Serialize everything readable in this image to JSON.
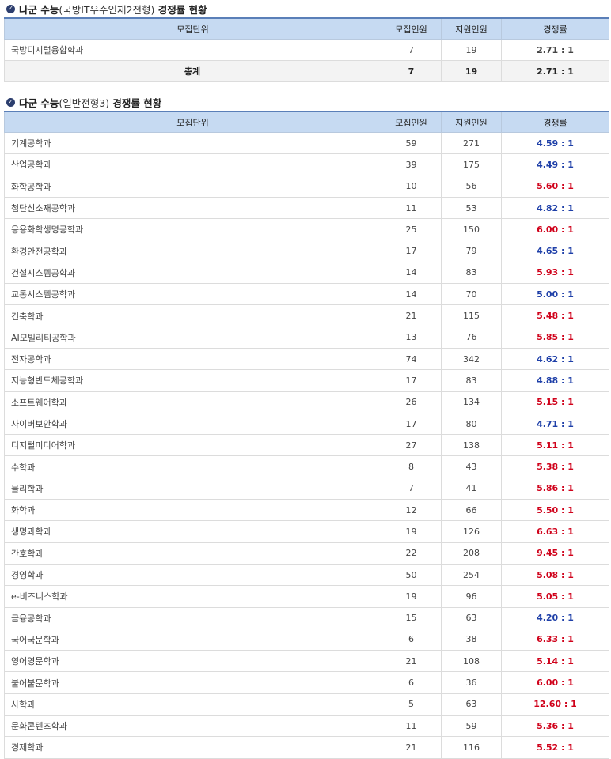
{
  "section1": {
    "title_main": "나군 수능",
    "title_paren": "(국방IT우수인재2전형)",
    "title_tail": " 경쟁률 현황",
    "headers": [
      "모집단위",
      "모집인원",
      "지원인원",
      "경쟁률"
    ],
    "rows": [
      {
        "name": "국방디지털융합학과",
        "quota": "7",
        "applicants": "19",
        "rate": "2.71 : 1"
      }
    ],
    "total": {
      "name": "총계",
      "quota": "7",
      "applicants": "19",
      "rate": "2.71 : 1"
    }
  },
  "section2": {
    "title_main": "다군 수능",
    "title_paren": "(일반전형3)",
    "title_tail": " 경쟁률 현황",
    "headers": [
      "모집단위",
      "모집인원",
      "지원인원",
      "경쟁률"
    ],
    "rows": [
      {
        "name": "기계공학과",
        "quota": "59",
        "applicants": "271",
        "rate": "4.59 : 1",
        "color": "#1e3fa8"
      },
      {
        "name": "산업공학과",
        "quota": "39",
        "applicants": "175",
        "rate": "4.49 : 1",
        "color": "#1e3fa8"
      },
      {
        "name": "화학공학과",
        "quota": "10",
        "applicants": "56",
        "rate": "5.60 : 1",
        "color": "#d0021b"
      },
      {
        "name": "첨단신소재공학과",
        "quota": "11",
        "applicants": "53",
        "rate": "4.82 : 1",
        "color": "#1e3fa8"
      },
      {
        "name": "응용화학생명공학과",
        "quota": "25",
        "applicants": "150",
        "rate": "6.00 : 1",
        "color": "#d0021b"
      },
      {
        "name": "환경안전공학과",
        "quota": "17",
        "applicants": "79",
        "rate": "4.65 : 1",
        "color": "#1e3fa8"
      },
      {
        "name": "건설시스템공학과",
        "quota": "14",
        "applicants": "83",
        "rate": "5.93 : 1",
        "color": "#d0021b"
      },
      {
        "name": "교통시스템공학과",
        "quota": "14",
        "applicants": "70",
        "rate": "5.00 : 1",
        "color": "#1e3fa8"
      },
      {
        "name": "건축학과",
        "quota": "21",
        "applicants": "115",
        "rate": "5.48 : 1",
        "color": "#d0021b"
      },
      {
        "name": "AI모빌리티공학과",
        "quota": "13",
        "applicants": "76",
        "rate": "5.85 : 1",
        "color": "#d0021b"
      },
      {
        "name": "전자공학과",
        "quota": "74",
        "applicants": "342",
        "rate": "4.62 : 1",
        "color": "#1e3fa8"
      },
      {
        "name": "지능형반도체공학과",
        "quota": "17",
        "applicants": "83",
        "rate": "4.88 : 1",
        "color": "#1e3fa8"
      },
      {
        "name": "소프트웨어학과",
        "quota": "26",
        "applicants": "134",
        "rate": "5.15 : 1",
        "color": "#d0021b"
      },
      {
        "name": "사이버보안학과",
        "quota": "17",
        "applicants": "80",
        "rate": "4.71 : 1",
        "color": "#1e3fa8"
      },
      {
        "name": "디지털미디어학과",
        "quota": "27",
        "applicants": "138",
        "rate": "5.11 : 1",
        "color": "#d0021b"
      },
      {
        "name": "수학과",
        "quota": "8",
        "applicants": "43",
        "rate": "5.38 : 1",
        "color": "#d0021b"
      },
      {
        "name": "물리학과",
        "quota": "7",
        "applicants": "41",
        "rate": "5.86 : 1",
        "color": "#d0021b"
      },
      {
        "name": "화학과",
        "quota": "12",
        "applicants": "66",
        "rate": "5.50 : 1",
        "color": "#d0021b"
      },
      {
        "name": "생명과학과",
        "quota": "19",
        "applicants": "126",
        "rate": "6.63 : 1",
        "color": "#d0021b"
      },
      {
        "name": "간호학과",
        "quota": "22",
        "applicants": "208",
        "rate": "9.45 : 1",
        "color": "#d0021b"
      },
      {
        "name": "경영학과",
        "quota": "50",
        "applicants": "254",
        "rate": "5.08 : 1",
        "color": "#d0021b"
      },
      {
        "name": "e-비즈니스학과",
        "quota": "19",
        "applicants": "96",
        "rate": "5.05 : 1",
        "color": "#d0021b"
      },
      {
        "name": "금융공학과",
        "quota": "15",
        "applicants": "63",
        "rate": "4.20 : 1",
        "color": "#1e3fa8"
      },
      {
        "name": "국어국문학과",
        "quota": "6",
        "applicants": "38",
        "rate": "6.33 : 1",
        "color": "#d0021b"
      },
      {
        "name": "영어영문학과",
        "quota": "21",
        "applicants": "108",
        "rate": "5.14 : 1",
        "color": "#d0021b"
      },
      {
        "name": "불어불문학과",
        "quota": "6",
        "applicants": "36",
        "rate": "6.00 : 1",
        "color": "#d0021b"
      },
      {
        "name": "사학과",
        "quota": "5",
        "applicants": "63",
        "rate": "12.60 : 1",
        "color": "#d0021b"
      },
      {
        "name": "문화콘텐츠학과",
        "quota": "11",
        "applicants": "59",
        "rate": "5.36 : 1",
        "color": "#d0021b"
      },
      {
        "name": "경제학과",
        "quota": "21",
        "applicants": "116",
        "rate": "5.52 : 1",
        "color": "#d0021b"
      }
    ]
  }
}
